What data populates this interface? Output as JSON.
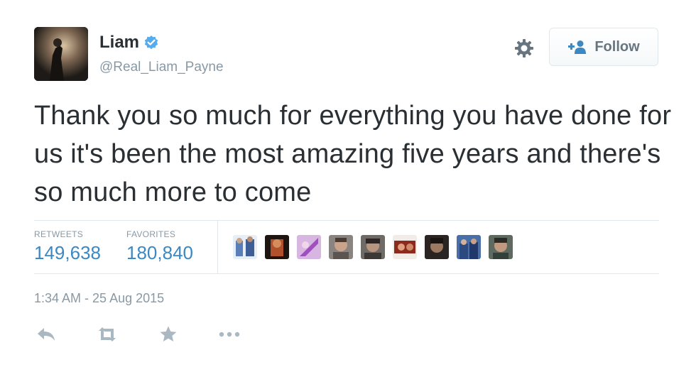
{
  "user": {
    "display_name": "Liam",
    "handle": "@Real_Liam_Payne",
    "verified": true
  },
  "header": {
    "follow_label": "Follow"
  },
  "tweet": {
    "text": "Thank you so much for everything you have done for us it's been the most amazing five years and there's so much more to come",
    "timestamp": "1:34 AM - 25 Aug 2015"
  },
  "stats": {
    "retweets_label": "RETWEETS",
    "retweets_value": "149,638",
    "favorites_label": "FAVORITES",
    "favorites_value": "180,840"
  },
  "colors": {
    "text": "#292f33",
    "muted": "#8899a6",
    "link": "#3b88c3",
    "verified": "#55acee",
    "border": "#e1e8ed"
  },
  "icons": {
    "verified": "verified-badge-icon",
    "settings": "gear-icon",
    "follow": "add-user-icon",
    "reply": "reply-icon",
    "retweet": "retweet-icon",
    "favorite": "star-icon",
    "more": "more-icon"
  }
}
